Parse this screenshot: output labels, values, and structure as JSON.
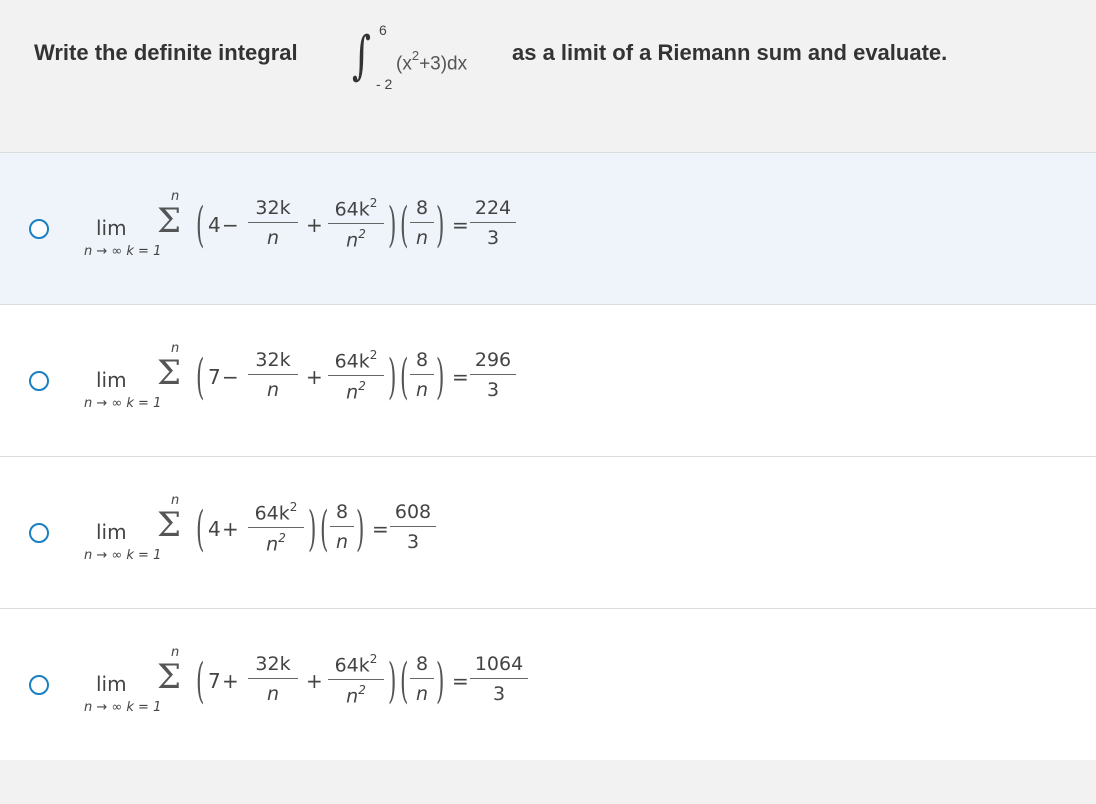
{
  "question": {
    "prefix": "Write the definite integral",
    "suffix": "as a limit of a Riemann sum and evaluate.",
    "integral": {
      "upper": "6",
      "lower": "- 2",
      "integrand_a": "(x",
      "integrand_exp": "2",
      "integrand_b": "+3)dx"
    }
  },
  "choices": [
    {
      "start": "4",
      "op1": "−",
      "has_linear": true,
      "op2": "+",
      "result_num": "224",
      "result_den": "3"
    },
    {
      "start": "7",
      "op1": "−",
      "has_linear": true,
      "op2": "+",
      "result_num": "296",
      "result_den": "3"
    },
    {
      "start": "4",
      "op1": "+",
      "has_linear": false,
      "op2": "",
      "result_num": "608",
      "result_den": "3"
    },
    {
      "start": "7",
      "op1": "+",
      "has_linear": true,
      "op2": "+",
      "result_num": "1064",
      "result_den": "3"
    }
  ],
  "math": {
    "lim": "lim",
    "sub_n": "n",
    "arrow": "→ ∞",
    "sub_k": "k = 1",
    "upper_n": "n",
    "sigma": "Σ",
    "lin_num": "32k",
    "lin_den": "n",
    "quad_num": "64k",
    "quad_num_exp": "2",
    "quad_den": "n",
    "quad_den_exp": "2",
    "dx_num": "8",
    "dx_den": "n",
    "equals": "="
  }
}
